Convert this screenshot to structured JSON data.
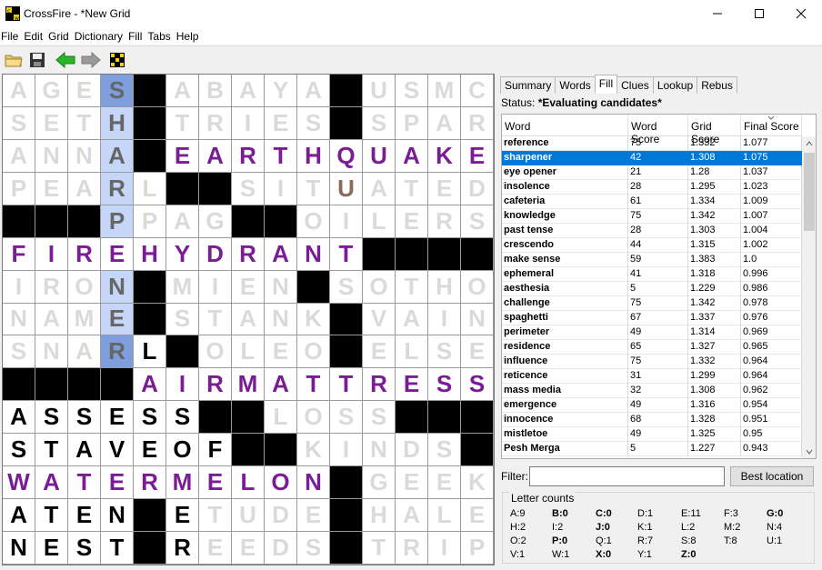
{
  "window": {
    "title": "CrossFire - *New Grid"
  },
  "menu": [
    "File",
    "Edit",
    "Grid",
    "Dictionary",
    "Fill",
    "Tabs",
    "Help"
  ],
  "toolbar": {
    "icons": [
      "open-folder-icon",
      "save-icon",
      "back-arrow-icon",
      "forward-arrow-icon",
      "grid-icon"
    ]
  },
  "grid": {
    "rows": [
      [
        "AF",
        "GF",
        "EF",
        "SC",
        "#",
        "AF",
        "BF",
        "AF",
        "YF",
        "AF",
        "#",
        "UF",
        "SF",
        "MF",
        "CF"
      ],
      [
        "SF",
        "EF",
        "TF",
        "HS",
        "#",
        "TF",
        "RF",
        "IF",
        "EF",
        "SF",
        "#",
        "SF",
        "PF",
        "AF",
        "RF"
      ],
      [
        "AF",
        "NF",
        "NF",
        "AS",
        "#",
        "EP",
        "AP",
        "RP",
        "TP",
        "HP",
        "QP",
        "UP",
        "AP",
        "KP",
        "EP"
      ],
      [
        "PF",
        "EF",
        "AF",
        "RS",
        "LF",
        "#",
        "#",
        "SF",
        "IF",
        "TF",
        "UU",
        "AF",
        "TF",
        "EF",
        "DF"
      ],
      [
        "#",
        "#",
        "#",
        "PS",
        "PF",
        "AF",
        "GF",
        "#",
        "#",
        "OF",
        "IF",
        "LF",
        "EF",
        "RF",
        "SF"
      ],
      [
        "FP",
        "IP",
        "RP",
        "EP",
        "HP",
        "YP",
        "DP",
        "RP",
        "AP",
        "NP",
        "TP",
        "#",
        "#",
        "#",
        "#"
      ],
      [
        "IF",
        "RF",
        "OF",
        "NS",
        "#",
        "MF",
        "IF",
        "EF",
        "NF",
        "#",
        "SF",
        "OF",
        "TF",
        "HF",
        "OF"
      ],
      [
        "NF",
        "AF",
        "MF",
        "ES",
        "#",
        "SF",
        "TF",
        "AF",
        "NF",
        "KF",
        "#",
        "VF",
        "AF",
        "IF",
        "NF"
      ],
      [
        "SF",
        "NF",
        "AF",
        "RC",
        "LB",
        "#",
        "OF",
        "LF",
        "EF",
        "OF",
        "#",
        "EF",
        "LF",
        "SF",
        "EF"
      ],
      [
        "#",
        "#",
        "#",
        "#",
        "AP",
        "IP",
        "RP",
        "MP",
        "AP",
        "TP",
        "TP",
        "RP",
        "EP",
        "SP",
        "SP"
      ],
      [
        "AB",
        "SB",
        "SB",
        "EB",
        "SB",
        "SB",
        "#",
        "#",
        "LF",
        "OF",
        "SF",
        "SF",
        "#",
        "#",
        "#"
      ],
      [
        "SB",
        "TB",
        "AB",
        "VB",
        "EB",
        "OB",
        "FB",
        "#",
        "#",
        "KF",
        "IF",
        "NF",
        "DF",
        "SF",
        "#"
      ],
      [
        "WP",
        "AP",
        "TP",
        "EP",
        "RP",
        "MP",
        "EP",
        "LP",
        "OP",
        "NP",
        "#",
        "GF",
        "EF",
        "EF",
        "KF"
      ],
      [
        "AB",
        "TB",
        "EB",
        "NB",
        "#",
        "EB",
        "TF",
        "UF",
        "DF",
        "EF",
        "#",
        "HF",
        "AF",
        "LF",
        "EF"
      ],
      [
        "NB",
        "EB",
        "SB",
        "TB",
        "#",
        "RB",
        "EF",
        "EF",
        "DF",
        "SF",
        "#",
        "TF",
        "RF",
        "IF",
        "PF"
      ]
    ]
  },
  "panel": {
    "tabs": [
      "Summary",
      "Words",
      "Fill",
      "Clues",
      "Lookup",
      "Rebus"
    ],
    "active_tab": "Fill",
    "status_label": "Status:",
    "status_value": "*Evaluating candidates*",
    "columns": [
      "Word",
      "Word Score",
      "Grid Score",
      "Final Score"
    ],
    "rows": [
      [
        "reference",
        "75",
        "1.332",
        "1.077"
      ],
      [
        "sharpener",
        "42",
        "1.308",
        "1.075"
      ],
      [
        "eye opener",
        "21",
        "1.28",
        "1.037"
      ],
      [
        "insolence",
        "28",
        "1.295",
        "1.023"
      ],
      [
        "cafeteria",
        "61",
        "1.334",
        "1.009"
      ],
      [
        "knowledge",
        "75",
        "1.342",
        "1.007"
      ],
      [
        "past tense",
        "28",
        "1.303",
        "1.004"
      ],
      [
        "crescendo",
        "44",
        "1.315",
        "1.002"
      ],
      [
        "make sense",
        "59",
        "1.383",
        "1.0"
      ],
      [
        "ephemeral",
        "41",
        "1.318",
        "0.996"
      ],
      [
        "aesthesia",
        "5",
        "1.229",
        "0.986"
      ],
      [
        "challenge",
        "75",
        "1.342",
        "0.978"
      ],
      [
        "spaghetti",
        "67",
        "1.337",
        "0.976"
      ],
      [
        "perimeter",
        "49",
        "1.314",
        "0.969"
      ],
      [
        "residence",
        "65",
        "1.327",
        "0.965"
      ],
      [
        "influence",
        "75",
        "1.332",
        "0.964"
      ],
      [
        "reticence",
        "31",
        "1.299",
        "0.964"
      ],
      [
        "mass media",
        "32",
        "1.308",
        "0.962"
      ],
      [
        "emergence",
        "49",
        "1.316",
        "0.954"
      ],
      [
        "innocence",
        "68",
        "1.328",
        "0.951"
      ],
      [
        "mistletoe",
        "49",
        "1.325",
        "0.95"
      ],
      [
        "Pesh Merga",
        "5",
        "1.227",
        "0.943"
      ]
    ],
    "selected_row": 1,
    "filter_label": "Filter:",
    "filter_value": "",
    "best_location_label": "Best location",
    "letter_counts_title": "Letter counts",
    "letter_counts": [
      [
        "A:9",
        "B:0",
        "C:0",
        "D:1",
        "E:11",
        "F:3",
        "G:0"
      ],
      [
        "H:2",
        "I:2",
        "J:0",
        "K:1",
        "L:2",
        "M:2",
        "N:4"
      ],
      [
        "O:2",
        "P:0",
        "Q:1",
        "R:7",
        "S:8",
        "T:8",
        "U:1"
      ],
      [
        "V:1",
        "W:1",
        "X:0",
        "Y:1",
        "Z:0"
      ]
    ],
    "bold_counts": [
      "B:0",
      "C:0",
      "G:0",
      "J:0",
      "P:0",
      "X:0",
      "Z:0"
    ]
  },
  "colors": {
    "selected_row": "#0078d7",
    "theme_word": "#7a1c94",
    "highlight": "#c6d6f8",
    "cursor": "#7f9ede"
  }
}
